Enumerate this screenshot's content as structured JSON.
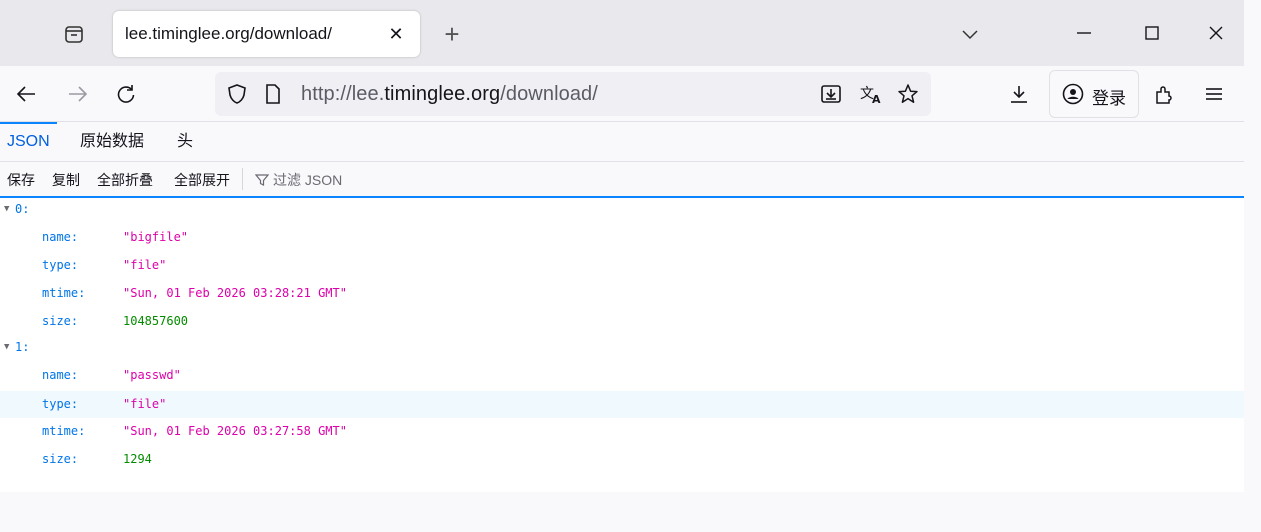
{
  "tab": {
    "title": "lee.timinglee.org/download/",
    "close": "✕",
    "new": "+"
  },
  "window": {
    "minimize": "—",
    "maximize": "☐",
    "close": "✕"
  },
  "nav": {
    "url_pre": "http://lee.",
    "url_host": "timinglee.org",
    "url_post": "/download/",
    "login_label": "登录"
  },
  "jsonviewer": {
    "tabs": [
      "JSON",
      "原始数据",
      "头"
    ],
    "toolbar": {
      "save": "保存",
      "copy": "复制",
      "collapse_all": "全部折叠",
      "expand_all": "全部展开",
      "filter_placeholder": "过滤 JSON"
    }
  },
  "tree": {
    "items": [
      {
        "index": "0:",
        "fields": [
          {
            "key": "name:",
            "value": "\"bigfile\""
          },
          {
            "key": "type:",
            "value": "\"file\""
          },
          {
            "key": "mtime:",
            "value": "\"Sun, 01 Feb 2026 03:28:21 GMT\""
          },
          {
            "key": "size:",
            "value": "104857600"
          }
        ]
      },
      {
        "index": "1:",
        "fields": [
          {
            "key": "name:",
            "value": "\"passwd\""
          },
          {
            "key": "type:",
            "value": "\"file\""
          },
          {
            "key": "mtime:",
            "value": "\"Sun, 01 Feb 2026 03:27:58 GMT\""
          },
          {
            "key": "size:",
            "value": "1294"
          }
        ]
      }
    ]
  },
  "icons": [
    "tab-list-icon",
    "chevron-down-icon",
    "back-arrow-icon",
    "forward-arrow-icon",
    "reload-icon",
    "shield-icon",
    "page-icon",
    "reader-download-icon",
    "translate-icon",
    "star-icon",
    "downloads-icon",
    "account-icon",
    "extensions-icon",
    "menu-icon",
    "filter-icon"
  ]
}
